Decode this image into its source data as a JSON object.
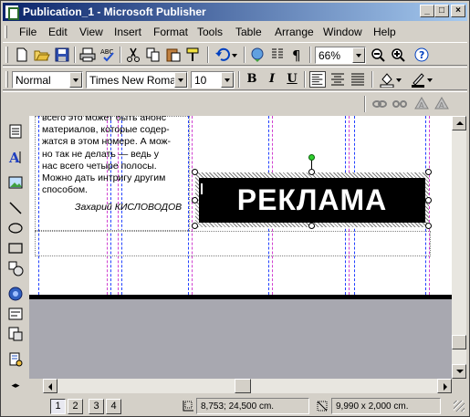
{
  "window": {
    "title": "Publication_1 - Microsoft Publisher"
  },
  "menu": [
    "File",
    "Edit",
    "View",
    "Insert",
    "Format",
    "Tools",
    "Table",
    "Arrange",
    "Window",
    "Help"
  ],
  "standard_toolbar": {
    "zoom": "66%",
    "icons": [
      "new-icon",
      "open-icon",
      "save-icon",
      "print-icon",
      "print-preview-icon",
      "spelling-icon",
      "cut-icon",
      "copy-icon",
      "paste-icon",
      "format-painter-icon",
      "undo-icon",
      "insert-hyperlink-icon",
      "columns-icon",
      "show-paragraph-marks-icon",
      "zoom-out-icon",
      "zoom-in-icon",
      "help-icon"
    ]
  },
  "formatting_toolbar": {
    "style": "Normal",
    "font": "Times New Roman",
    "size": "10",
    "bold": "B",
    "italic": "I",
    "underline": "U"
  },
  "document": {
    "body_text": "всего это может быть анонс\nматериалов, которые содер-\nжатся в этом номере. А мож-\nно так не делать — ведь у\nнас всего четыре полосы.\nМожно дать интригу другим\nспособом.",
    "author": "Захарий КИСЛОВОДОВ",
    "ad_text": "РЕКЛАМА"
  },
  "status": {
    "pages": [
      "1",
      "2",
      "3",
      "4"
    ],
    "active_page": "1",
    "position": "8,753; 24,500 cm.",
    "size": "9,990 x   2,000 cm."
  },
  "colors": {
    "titlebar_start": "#0a246a",
    "titlebar_end": "#a6caf0",
    "chrome": "#d4d0c8",
    "workspace": "#a8a8b0"
  }
}
